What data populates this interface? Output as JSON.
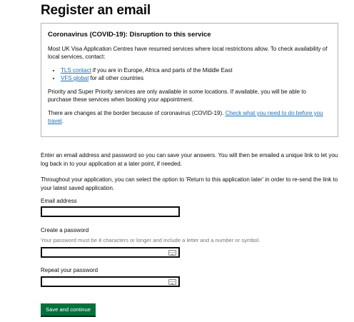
{
  "page": {
    "title": "Register an email"
  },
  "notice": {
    "heading": "Coronavirus (COVID-19): Disruption to this service",
    "para1": "Most UK Visa Application Centres have resumed services where local restrictions allow. To check availability of local services, contact:",
    "list": [
      {
        "link": "TLS contact",
        "text": " if you are in Europe, Africa and parts of the Middle East"
      },
      {
        "link": "VFS global",
        "text": " for all other countries"
      }
    ],
    "para2": "Priority and Super Priority services are only available in some locations. If available, you will be able to purchase these services when booking your appointment.",
    "para3": "There are changes at the border because of coronavirus (COVID-19). ",
    "para3_link": "Check what you need to do before you travel",
    "para3_end": "."
  },
  "intro": {
    "para1": "Enter an email address and password so you can save your answers. You will then be emailed a unique link to let you log back in to your application at a later point, if needed.",
    "para2": "Throughout your application, you can select the option to 'Return to this application later' in order to re-send the link to your latest saved application."
  },
  "form": {
    "email_label": "Email address",
    "email_value": "",
    "password_label": "Create a password",
    "password_hint": "Your password must be 8 characters or longer and include a letter and a number or symbol.",
    "password_value": "",
    "repeat_label": "Repeat your password",
    "repeat_value": "",
    "submit_label": "Save and continue"
  },
  "colors": {
    "link": "#1d70b8",
    "button": "#00703c",
    "text": "#0b0c0c",
    "hint": "#6f777b"
  },
  "icons": {
    "password_field": "password-key-icon"
  }
}
